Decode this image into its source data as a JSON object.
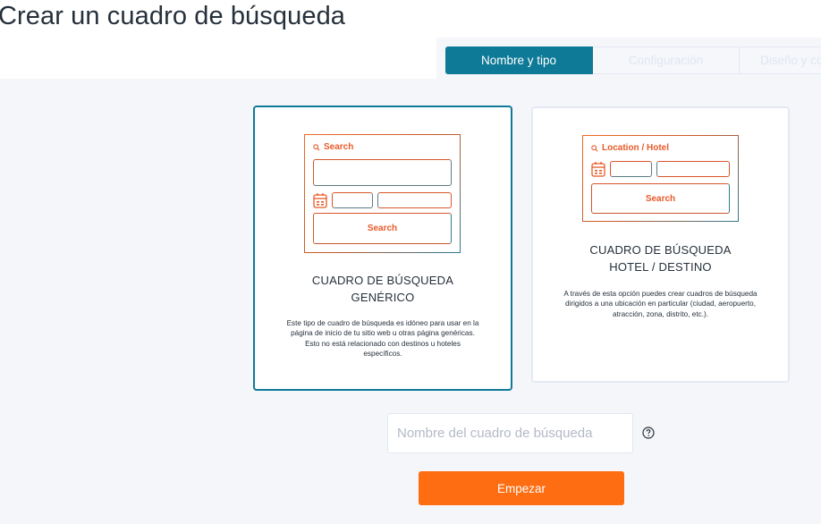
{
  "page": {
    "title": "Crear un cuadro de búsqueda"
  },
  "steps": [
    {
      "label": "Nombre y tipo",
      "state": "active"
    },
    {
      "label": "Configuración",
      "state": "disabled"
    },
    {
      "label": "Diseño y co",
      "state": "disabled"
    }
  ],
  "cards": [
    {
      "id": "generic",
      "selected": true,
      "preview": {
        "search_label": "Search",
        "button_label": "Search"
      },
      "title_line1": "CUADRO DE BÚSQUEDA",
      "title_line2": "GENÉRICO",
      "description": "Este tipo de cuadro de búsqueda es idóneo para usar en la página de inicio de tu sitio web u otras página genéricas. Esto no está relacionado con destinos u hoteles específicos."
    },
    {
      "id": "hotel",
      "selected": false,
      "preview": {
        "search_label": "Location / Hotel",
        "button_label": "Search"
      },
      "title_line1": "CUADRO DE BÚSQUEDA",
      "title_line2": "HOTEL / DESTINO",
      "description": "A través de esta opción puedes crear cuadros de búsqueda dirigidos a una ubicación en particular (ciudad, aeropuerto, atracción, zona, distrito, etc.)."
    }
  ],
  "name_field": {
    "value": "",
    "placeholder": "Nombre del cuadro de búsqueda"
  },
  "start_button": {
    "label": "Empezar"
  },
  "colors": {
    "accent_teal": "#0e7a97",
    "accent_orange": "#ff6d12",
    "preview_orange": "#e85a2a"
  }
}
